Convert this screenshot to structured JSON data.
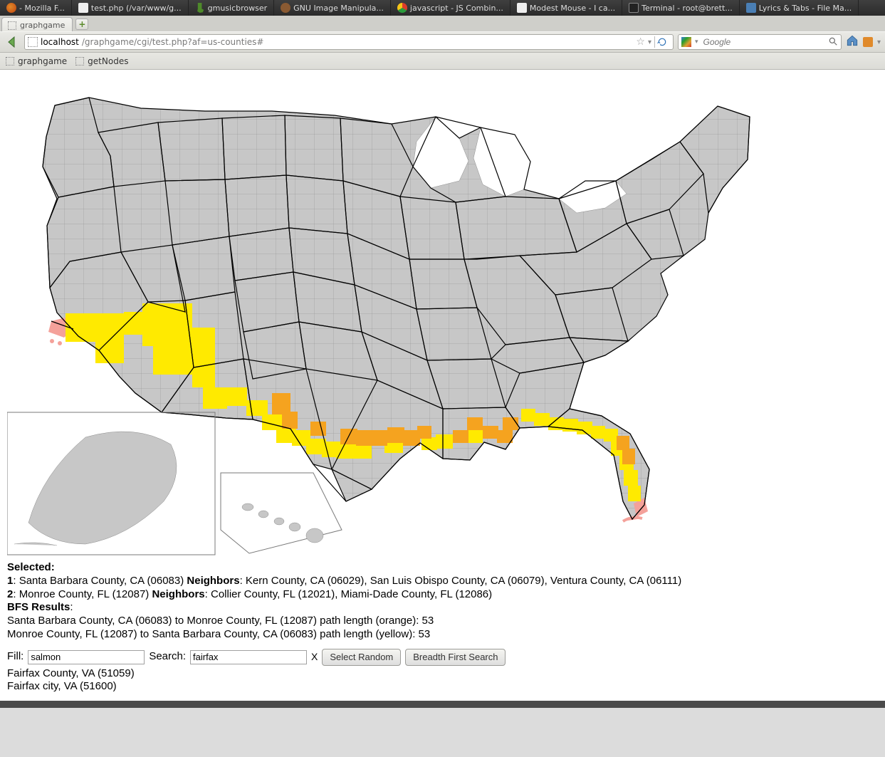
{
  "taskbar": [
    {
      "label": "- Mozilla F...",
      "icon": "ff"
    },
    {
      "label": "test.php (/var/www/g...",
      "icon": "doc"
    },
    {
      "label": "gmusicbrowser",
      "icon": "note"
    },
    {
      "label": "GNU Image Manipula...",
      "icon": "gimp"
    },
    {
      "label": "javascript - JS Combin...",
      "icon": "chrome"
    },
    {
      "label": "Modest Mouse - I ca...",
      "icon": "doc"
    },
    {
      "label": "Terminal - root@brett...",
      "icon": "term"
    },
    {
      "label": "Lyrics & Tabs - File Ma...",
      "icon": "fm"
    }
  ],
  "browser": {
    "tab_title": "graphgame",
    "url_host": "localhost",
    "url_rest": "/graphgame/cgi/test.php?af=us-counties#",
    "search_placeholder": "Google",
    "bookmarks": [
      "graphgame",
      "getNodes"
    ]
  },
  "selected": {
    "heading": "Selected:",
    "item1_prefix": "1",
    "item1_county": "Santa Barbara County, CA (06083)",
    "item1_neighlabel": "Neighbors",
    "item1_neighbors": "Kern County, CA (06029), San Luis Obispo County, CA (06079), Ventura County, CA (06111)",
    "item2_prefix": "2",
    "item2_county": "Monroe County, FL (12087)",
    "item2_neighlabel": "Neighbors",
    "item2_neighbors": "Collier County, FL (12021), Miami-Dade County, FL (12086)"
  },
  "bfs": {
    "heading": "BFS Results",
    "line1": "Santa Barbara County, CA (06083) to Monroe County, FL (12087) path length (orange): 53",
    "line2": "Monroe County, FL (12087) to Santa Barbara County, CA (06083) path length (yellow): 53"
  },
  "controls": {
    "fill_label": "Fill:",
    "fill_value": "salmon",
    "search_label": "Search:",
    "search_value": "fairfax",
    "clear": "X",
    "btn_random": "Select Random",
    "btn_bfs": "Breadth First Search"
  },
  "search_results": [
    "Fairfax County, VA (51059)",
    "Fairfax city, VA (51600)"
  ]
}
